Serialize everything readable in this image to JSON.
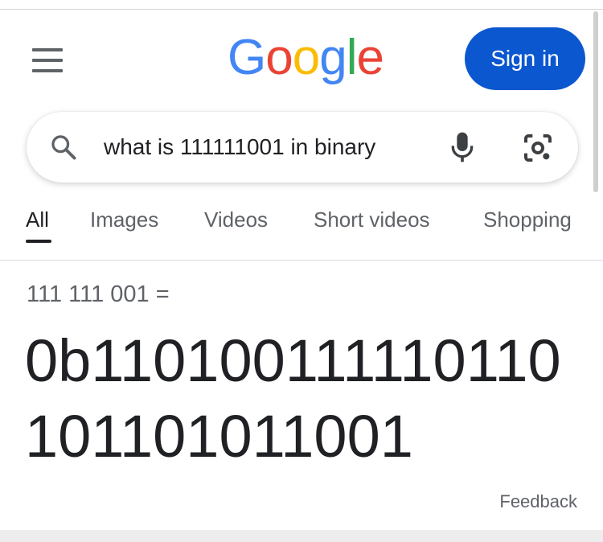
{
  "header": {
    "logo_letters": [
      {
        "char": "G",
        "color": "#4285F4"
      },
      {
        "char": "o",
        "color": "#EA4335"
      },
      {
        "char": "o",
        "color": "#FBBC05"
      },
      {
        "char": "g",
        "color": "#4285F4"
      },
      {
        "char": "l",
        "color": "#34A853"
      },
      {
        "char": "e",
        "color": "#EA4335"
      }
    ],
    "menu_icon": "hamburger-menu-icon",
    "signin_label": "Sign in",
    "signin_color": "#0B57D0"
  },
  "search": {
    "query": "what is 111111001 in binary",
    "search_icon": "search-icon",
    "voice_icon": "microphone-icon",
    "lens_icon": "camera-lens-icon"
  },
  "tabs": [
    {
      "label": "All",
      "active": true
    },
    {
      "label": "Images",
      "active": false
    },
    {
      "label": "Videos",
      "active": false
    },
    {
      "label": "Short videos",
      "active": false
    },
    {
      "label": "Shopping",
      "active": false
    }
  ],
  "calculator": {
    "expression": "111 111 001 =",
    "result": "0b110100111110110101101011001",
    "feedback_label": "Feedback"
  }
}
